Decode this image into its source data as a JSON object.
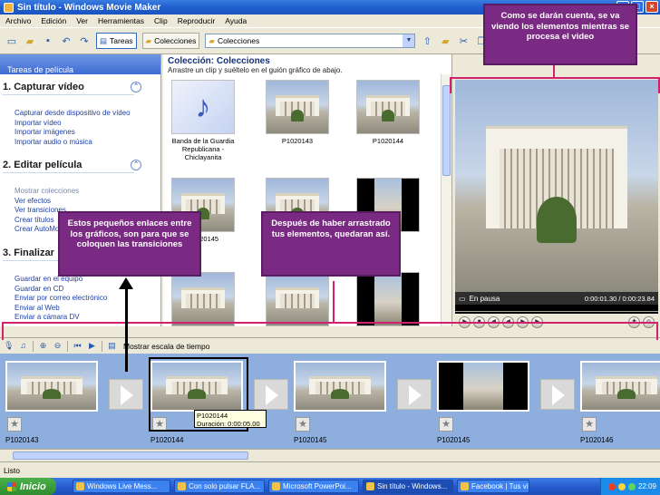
{
  "window": {
    "title": "Sin título - Windows Movie Maker",
    "buttons": {
      "minimize": "_",
      "maximize": "□",
      "close": "×"
    }
  },
  "menu": [
    "Archivo",
    "Edición",
    "Ver",
    "Herramientas",
    "Clip",
    "Reproducir",
    "Ayuda"
  ],
  "toolbar": {
    "tasks_label": "Tareas",
    "collections_label": "Colecciones",
    "collection_combo": "Colecciones"
  },
  "tasks": {
    "header": "Tareas de película",
    "sections": [
      {
        "title": "1. Capturar vídeo",
        "links": [
          "Capturar desde dispositivo de vídeo",
          "Importar vídeo",
          "Importar imágenes",
          "Importar audio o música"
        ]
      },
      {
        "title": "2. Editar película",
        "links": [
          "Mostrar colecciones",
          "Ver efectos",
          "Ver transiciones",
          "Crear títulos",
          "Crear AutoMovie"
        ]
      },
      {
        "title": "3. Finalizar",
        "links": [
          "Guardar en el equipo",
          "Guardar en CD",
          "Enviar por correo electrónico",
          "Enviar al Web",
          "Enviar a cámara DV"
        ]
      }
    ]
  },
  "collection": {
    "title": "Colección: Colecciones",
    "subtitle": "Arrastre un clip y suéltelo en el guión gráfico de abajo.",
    "clips": [
      {
        "kind": "music",
        "caption": "Banda de la Guardia Republicana - Chiclayanita"
      },
      {
        "kind": "photo",
        "caption": "P1020143"
      },
      {
        "kind": "photo",
        "caption": "P1020144"
      },
      {
        "kind": "photo",
        "caption": "P1020145"
      },
      {
        "kind": "photo",
        "caption": ""
      },
      {
        "kind": "portrait",
        "caption": ""
      },
      {
        "kind": "photo",
        "caption": ""
      },
      {
        "kind": "photo",
        "caption": ""
      },
      {
        "kind": "portrait",
        "caption": ""
      }
    ]
  },
  "monitor": {
    "status": "En pausa",
    "time": "0:00:01.30 / 0:00:23.84"
  },
  "storyboard": {
    "toolbar_label": "Mostrar escala de tiempo",
    "clips": [
      {
        "name": "P1020143",
        "kind": "photo"
      },
      {
        "name": "P1020144",
        "kind": "photo"
      },
      {
        "name": "P1020145",
        "kind": "photo"
      },
      {
        "name": "P1020145",
        "kind": "portrait"
      },
      {
        "name": "P1020146",
        "kind": "photo"
      }
    ],
    "tooltip_name": "P1020144",
    "tooltip_duration": "Duración: 0:00:05.00"
  },
  "status_bar": "Listo",
  "taskbar": {
    "start": "Inicio",
    "items": [
      "Windows Live Mess...",
      "Con solo pulsar FLA...",
      "Microsoft PowerPoi...",
      "Sin título - Windows...",
      "Facebook | Tus víd..."
    ],
    "active_index": 3,
    "clock": "22:09"
  },
  "annotations": {
    "top_right": "Como se darán cuenta, se va viendo los elementos mientras  se procesa el video",
    "left": "Estos pequeños enlaces entre los gráficos, son para que se coloquen las transiciones",
    "center": "Después de haber arrastrado tus elementos, quedaran así."
  },
  "colors": {
    "annotation_fill": "#7a2a82",
    "bracket": "#d1206e",
    "storyboard_bg": "#8eaedd"
  }
}
